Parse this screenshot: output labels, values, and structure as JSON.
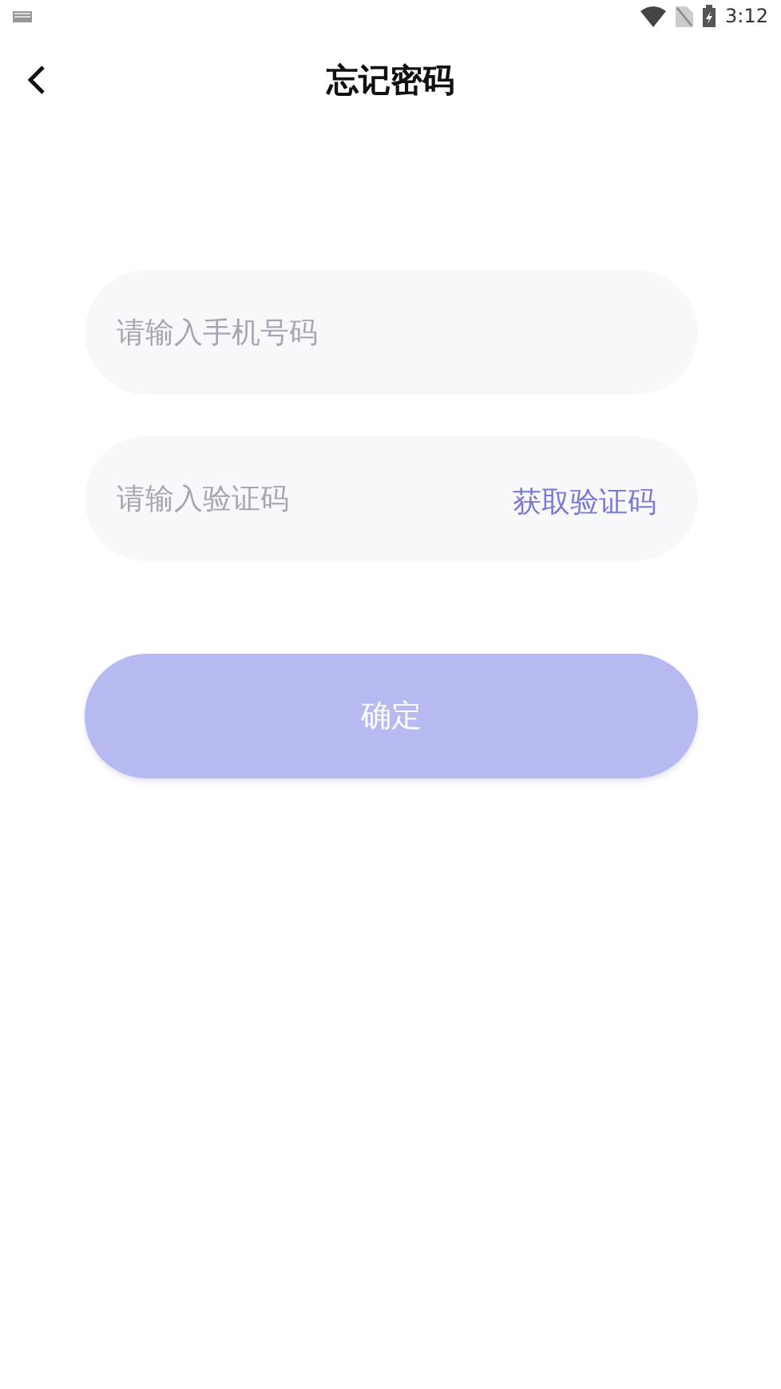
{
  "status_bar": {
    "time": "3:12"
  },
  "header": {
    "title": "忘记密码"
  },
  "phone_field": {
    "placeholder": "请输入手机号码"
  },
  "code_field": {
    "placeholder": "请输入验证码",
    "action": "获取验证码"
  },
  "confirm_button": {
    "label": "确定",
    "disabled": true
  }
}
